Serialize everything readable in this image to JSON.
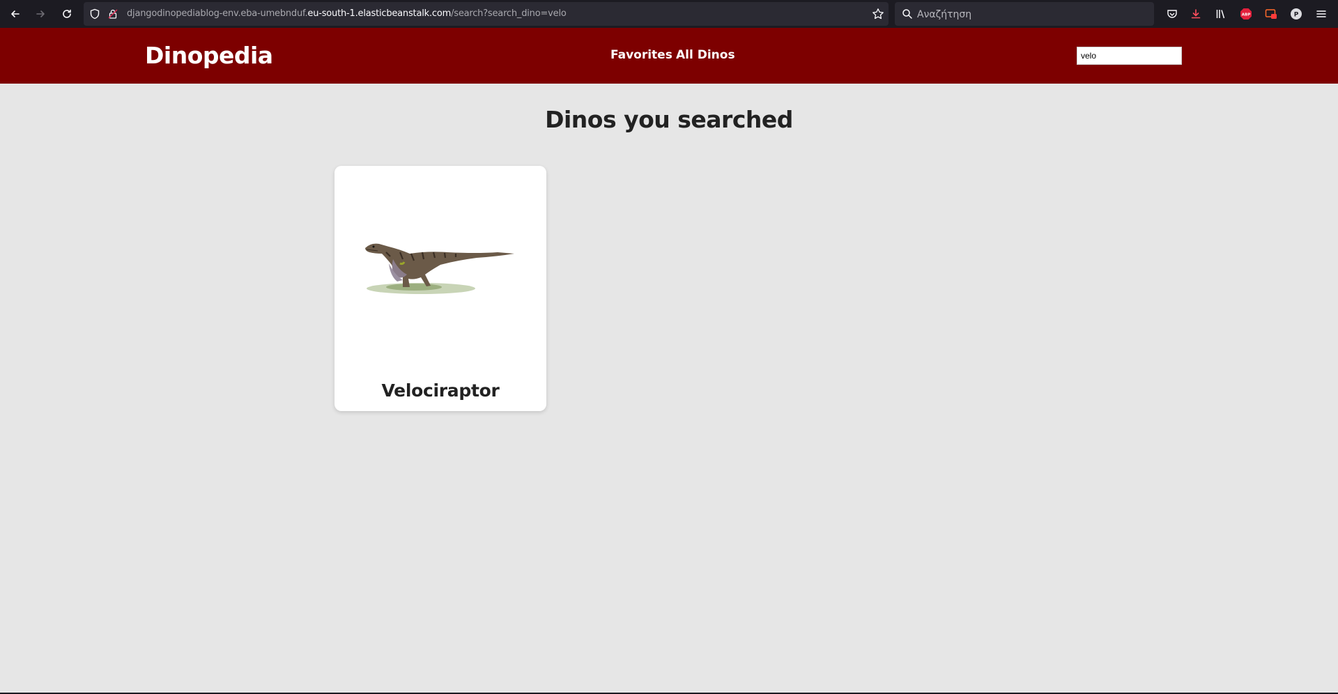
{
  "browser": {
    "url_prefix": "djangodinopediablog-env.eba-umebnduf.",
    "url_host": "eu-south-1.elasticbeanstalk.com",
    "url_path": "/search?search_dino=velo",
    "search_placeholder": "Αναζήτηση",
    "abp_label": "ABP",
    "profile_initial": "P"
  },
  "header": {
    "brand": "Dinopedia",
    "nav": [
      {
        "label": "Favorites"
      },
      {
        "label": "All Dinos"
      }
    ],
    "search_value": "velo"
  },
  "main": {
    "title": "Dinos you searched",
    "results": [
      {
        "name": "Velociraptor",
        "image_icon": "velociraptor-illustration"
      }
    ]
  },
  "colors": {
    "header_bg": "#7d0000",
    "page_bg": "#e6e6e6",
    "browser_bg": "#1c1b22"
  }
}
